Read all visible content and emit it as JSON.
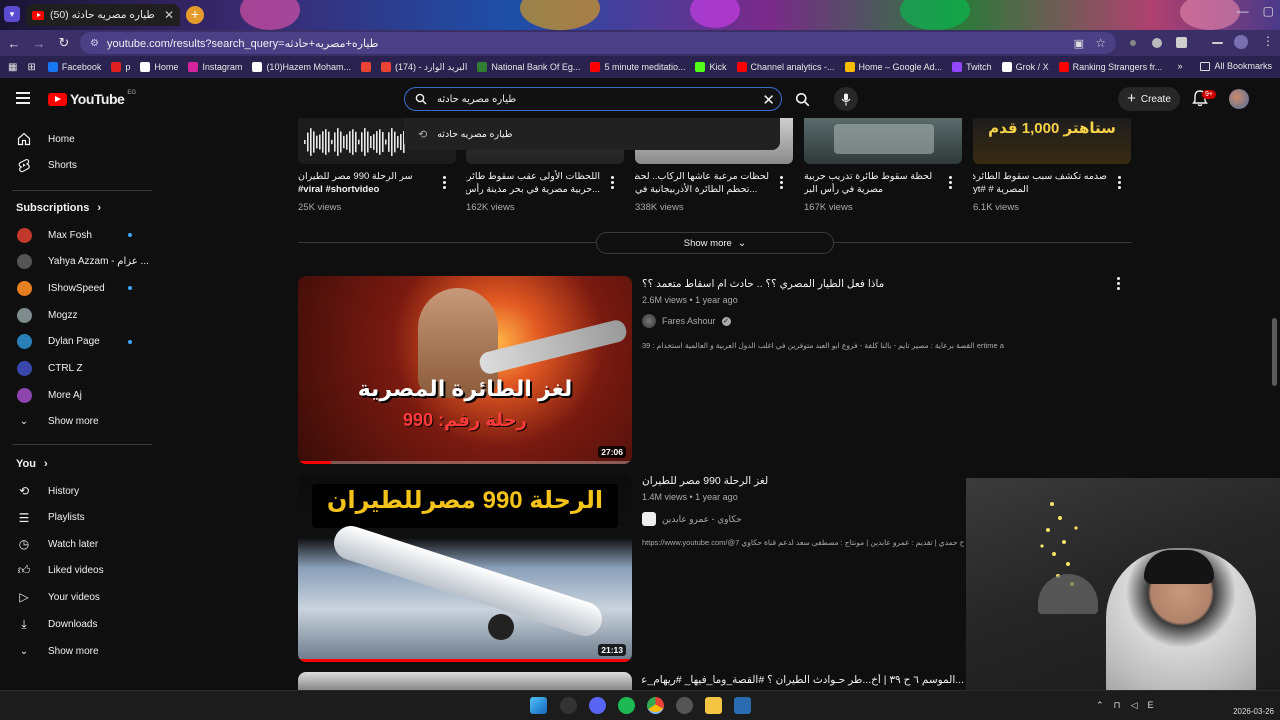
{
  "browser": {
    "tab_title": "(50) طياره مصريه حادثه - YouTube",
    "tab_close": "✕",
    "new_tab": "+",
    "url": "youtube.com/results?search_query=طياره+مصريه+حادثه",
    "bookmarks": [
      {
        "label": "Facebook",
        "color": "#1877f2"
      },
      {
        "label": "p",
        "color": "#e02020"
      },
      {
        "label": "Home",
        "color": "#ffffff"
      },
      {
        "label": "Instagram",
        "color": "#d6249f"
      },
      {
        "label": "(10)Hazem Moham...",
        "color": "#ffffff"
      },
      {
        "label": "",
        "color": "#ea4335"
      },
      {
        "label": "(174) - البريد الوارد",
        "color": "#ea4335"
      },
      {
        "label": "National Bank Of Eg...",
        "color": "#2e7d32"
      },
      {
        "label": "5 minute meditatio...",
        "color": "#ff0000"
      },
      {
        "label": "Kick",
        "color": "#53fc18"
      },
      {
        "label": "Channel analytics -...",
        "color": "#ff0000"
      },
      {
        "label": "Home – Google Ad...",
        "color": "#fbbc04"
      },
      {
        "label": "Twitch",
        "color": "#9146ff"
      },
      {
        "label": "Grok / X",
        "color": "#ffffff"
      },
      {
        "label": "Ranking Strangers fr...",
        "color": "#ff0000"
      }
    ],
    "all_bookmarks": "All Bookmarks"
  },
  "header": {
    "logo_text": "YouTube",
    "country_code": "EG",
    "search_value": "طياره مصريه حادثه",
    "create_label": "Create",
    "notification_badge": "9+"
  },
  "search_suggestion": "طياره مصريه حادثه",
  "sidebar": {
    "main": [
      {
        "label": "Home",
        "icon": "home-icon"
      },
      {
        "label": "Shorts",
        "icon": "shorts-icon"
      }
    ],
    "subscriptions_title": "Subscriptions",
    "subscriptions": [
      {
        "label": "Max Fosh",
        "color": "#c0392b",
        "dot": true
      },
      {
        "label": "Yahya Azzam - عزام ...",
        "color": "#555555",
        "dot": false
      },
      {
        "label": "IShowSpeed",
        "color": "#e67e22",
        "dot": true
      },
      {
        "label": "Mogzz",
        "color": "#7f8c8d",
        "dot": false
      },
      {
        "label": "Dylan Page",
        "color": "#2980b9",
        "dot": true
      },
      {
        "label": "CTRL Z",
        "color": "#3949ab",
        "dot": false
      },
      {
        "label": "More Aj",
        "color": "#8e44ad",
        "dot": false
      }
    ],
    "subs_show_more": "Show more",
    "you_title": "You",
    "you_items": [
      {
        "label": "History",
        "icon": "history-icon"
      },
      {
        "label": "Playlists",
        "icon": "playlists-icon"
      },
      {
        "label": "Watch later",
        "icon": "watch-later-icon"
      },
      {
        "label": "Liked videos",
        "icon": "like-icon"
      },
      {
        "label": "Your videos",
        "icon": "your-videos-icon"
      },
      {
        "label": "Downloads",
        "icon": "download-icon"
      }
    ],
    "you_show_more": "Show more"
  },
  "shorts": [
    {
      "title1": "سر الرحلة 990 مصر للطيران",
      "title2": "#viral #shortvideo",
      "views": "25K views"
    },
    {
      "title1": "اللحظات الأولى عقب سقوط طائرة",
      "title2": "...حربية مصرية في بحر مدينة رأس البر",
      "views": "162K views"
    },
    {
      "title1": "لحظات مرعبة عاشها الركاب.. لحظة",
      "title2": "...تحطم الطائرة الأذربيجانية في",
      "views": "338K views"
    },
    {
      "title1": "لحظة سقوط طائرة تدريب حربية",
      "title2": "مصرية في رأس البر",
      "views": "167K views"
    },
    {
      "title1": "صدمه تكشف سبب سقوط الطائرة",
      "title2": "المصرية # #yt",
      "views": "6.1K views"
    }
  ],
  "shorts_show_more": "Show more",
  "short5_overlay": "ستاهتر 1,000 قدم",
  "videos": [
    {
      "title": "ماذا فعل الطيار المصري ؟؟ .. حادث ام اسقاط متعمد ؟؟",
      "meta": "2.6M views • 1 year ago",
      "channel": "Fares Ashour",
      "verified": true,
      "description": "39 : القصة برعاية : مصير تايم - بالنا كلفة - فروع ابو العبد متوفرين في اغلب الدول العربية و العالمية استخدام ertime abo_alabdkw ...",
      "duration": "27:06",
      "watched_fraction": 0.1,
      "thumb_title": "لغز الطائرة المصرية",
      "thumb_sub": "رحلة رقم: 990"
    },
    {
      "title": "لغز الرحلة 990 مصر للطيران",
      "meta": "1.4M views • 1 year ago",
      "channel": "حكاوي - عمرو عابدين",
      "verified": false,
      "description": "https://www.youtube.com/@7 إعداد : سماح حمدي | تقديم : عمرو عابدين | مونتاج : مصطفى سعد لدعم قناة حكاوي",
      "duration": "21:13",
      "watched_fraction": 1.0,
      "thumb_title": "الرحلة 990 مصرللطيران",
      "thumb_num": "990"
    },
    {
      "title": "...الموسم ٦ ح ٣٩ | أخ...طر حـوادث الطيران ؟ #القصة_وما_فيها_ #ريهام_عياد"
    }
  ],
  "taskbar": {
    "time_label": "E",
    "date": "2026-03-26"
  },
  "colors": {
    "accent_red": "#ff0000",
    "link_blue": "#3ea6ff"
  }
}
